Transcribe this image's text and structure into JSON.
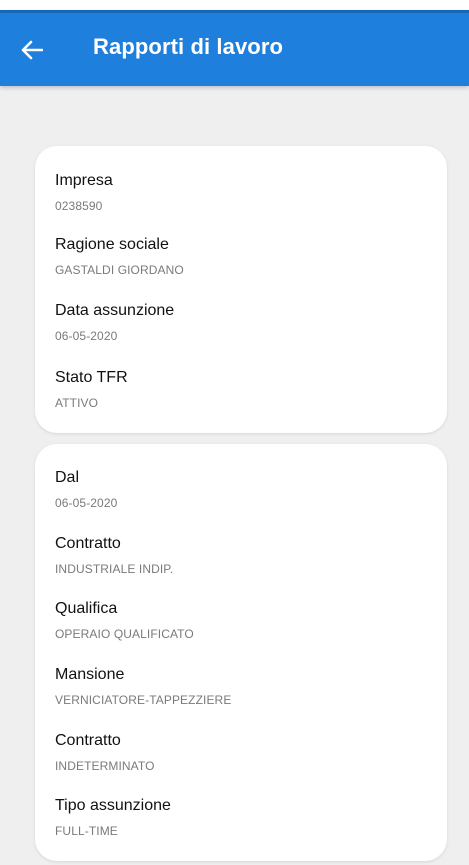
{
  "header": {
    "title": "Rapporti di lavoro"
  },
  "colors": {
    "appbar": "#1e7fdc",
    "background": "#efefef",
    "card": "#ffffff"
  },
  "card1": {
    "fields": [
      {
        "label": "Impresa",
        "value": "0238590"
      },
      {
        "label": "Ragione sociale",
        "value": "GASTALDI GIORDANO"
      },
      {
        "label": "Data assunzione",
        "value": "06-05-2020"
      },
      {
        "label": "Stato TFR",
        "value": "ATTIVO"
      }
    ]
  },
  "card2": {
    "fields": [
      {
        "label": "Dal",
        "value": "06-05-2020"
      },
      {
        "label": "Contratto",
        "value": "INDUSTRIALE INDIP."
      },
      {
        "label": "Qualifica",
        "value": "OPERAIO QUALIFICATO"
      },
      {
        "label": "Mansione",
        "value": "VERNICIATORE-TAPPEZZIERE"
      },
      {
        "label": "Contratto",
        "value": "INDETERMINATO"
      },
      {
        "label": "Tipo assunzione",
        "value": "FULL-TIME"
      }
    ]
  }
}
